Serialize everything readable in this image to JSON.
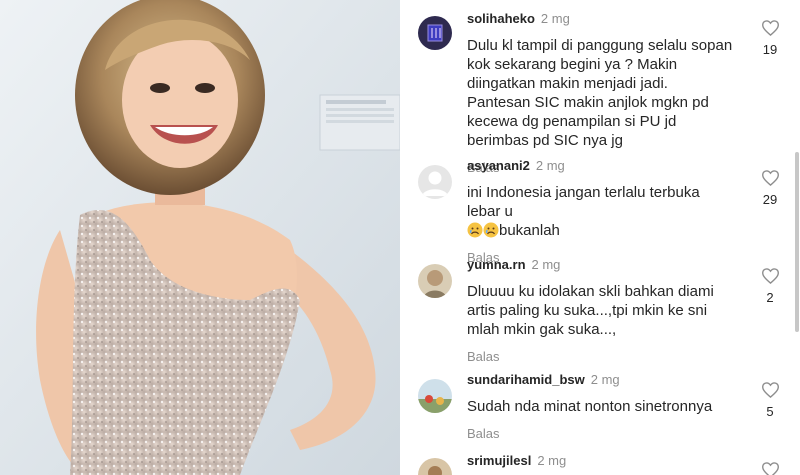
{
  "comments": [
    {
      "username": "solihaheko",
      "time": "2 mg",
      "text": "Dulu kl tampil di panggung selalu sopan kok sekarang begini ya ? Makin diingatkan makin menjadi jadi. Pantesan SIC makin anjlok mgkn pd kecewa dg penampilan si PU jd berimbas pd SIC nya jg",
      "reply": "Balas",
      "likes": "19"
    },
    {
      "username": "asyanani2",
      "time": "2 mg",
      "text": "ini Indonesia  jangan terlalu terbuka lebar u",
      "text_after_emoji": "bukanlah",
      "emoji": [
        "sad-face-emoji",
        "sad-face-emoji"
      ],
      "reply": "Balas",
      "likes": "29"
    },
    {
      "username": "yumna.rn",
      "time": "2 mg",
      "text": "Dluuuu ku idolakan skli bahkan diami artis paling ku suka...,tpi mkin ke sni mlah mkin gak suka...,",
      "reply": "Balas",
      "likes": "2"
    },
    {
      "username": "sundarihamid_bsw",
      "time": "2 mg",
      "text": "Sudah nda minat nonton sinetronnya",
      "reply": "Balas",
      "likes": "5"
    },
    {
      "username": "srimujilesl",
      "time": "2 mg"
    }
  ],
  "colors": {
    "username": "#262626",
    "muted": "#8e8e8e",
    "heart_outline": "#8e8e8e"
  }
}
